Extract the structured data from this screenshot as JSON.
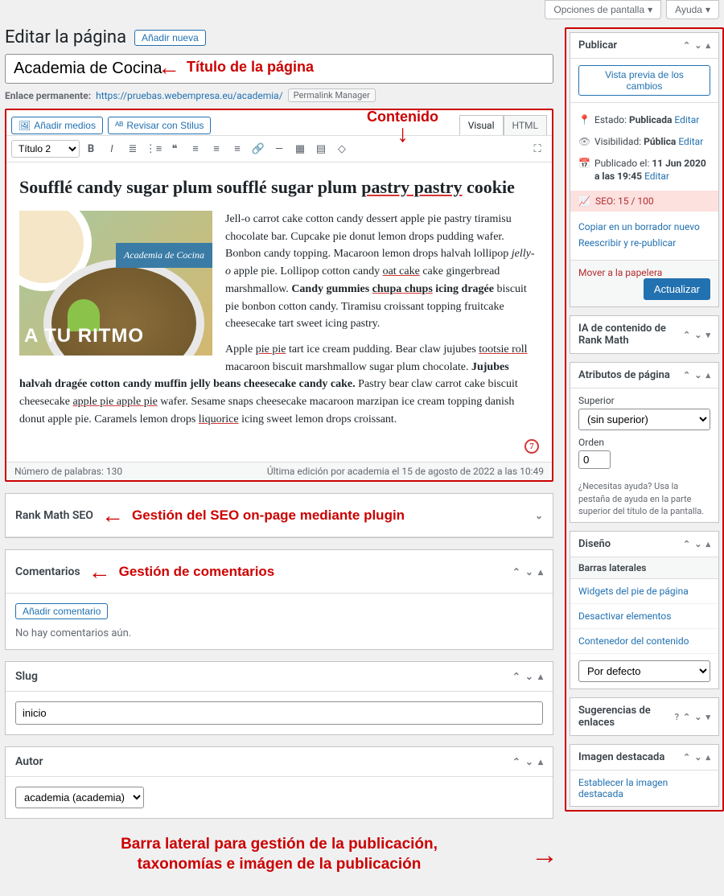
{
  "top": {
    "screen_options": "Opciones de pantalla",
    "help": "Ayuda"
  },
  "heading": {
    "title": "Editar la página",
    "add_new": "Añadir nueva"
  },
  "title_field": {
    "value": "Academia de Cocina"
  },
  "permalink": {
    "label": "Enlace permanente:",
    "url": "https://pruebas.webempresa.eu/academia/",
    "manager_btn": "Permalink Manager"
  },
  "editor_top": {
    "add_media": "Añadir medios",
    "stilus": "Revisar con Stilus",
    "tab_visual": "Visual",
    "tab_html": "HTML"
  },
  "tiny": {
    "format_sel": "Título 2"
  },
  "content": {
    "h2_a": "Soufflé candy sugar plum soufflé sugar plum ",
    "h2_u": "pastry pastry",
    "h2_b": " cookie",
    "img_band": "Academia de Cocina",
    "img_ritmo": "A TU RITMO",
    "p1_a": "Jell-o carrot cake cotton candy dessert apple pie pastry tiramisu chocolate bar. Cupcake pie donut lemon drops pudding wafer. Bonbon candy topping. Macaroon lemon drops halvah lollipop ",
    "p1_i": "jelly-o",
    "p1_b": " apple pie. Lollipop cotton candy ",
    "p1_u1": "oat cake",
    "p1_c": " cake gingerbread marshmallow. ",
    "p1_bold1": "Candy gummies ",
    "p1_u2": "chupa chups",
    "p1_bold2": " icing dragée",
    "p1_d": " biscuit pie bonbon cotton candy. Tiramisu croissant topping fruitcake cheesecake tart sweet icing pastry.",
    "p2_a": "Apple ",
    "p2_u1": "pie pie",
    "p2_b": " tart ice cream pudding. Bear claw jujubes ",
    "p2_u2": "tootsie roll",
    "p2_c": " macaroon biscuit marshmallow sugar plum chocolate. ",
    "p2_bold": "Jujubes halvah dragée cotton candy muffin jelly beans cheesecake candy cake.",
    "p2_d": " Pastry bear claw carrot cake biscuit cheesecake ",
    "p2_u3": "apple pie apple pie",
    "p2_e": " wafer. Sesame snaps cheesecake macaroon marzipan ice cream topping danish donut apple pie. Caramels lemon drops ",
    "p2_u4": "liquorice",
    "p2_f": " icing sweet lemon drops croissant.",
    "seo_num": "7"
  },
  "editor_footer": {
    "words": "Número de palabras: 130",
    "last_edit": "Última edición por academia el 15 de agosto de 2022 a las 10:49"
  },
  "metaboxes": {
    "rankmath": {
      "title": "Rank Math SEO"
    },
    "comments": {
      "title": "Comentarios",
      "add_btn": "Añadir comentario",
      "none": "No hay comentarios aún."
    },
    "slug": {
      "title": "Slug",
      "value": "inicio"
    },
    "author": {
      "title": "Autor",
      "value": "academia (academia)"
    }
  },
  "annotations": {
    "title": "Título de la página",
    "content": "Contenido",
    "seo": "Gestión del SEO on-page mediante plugin",
    "comments": "Gestión de comentarios",
    "sidebar1": "Barra lateral para gestión de la publicación,",
    "sidebar2": "taxonomías e imágen de la publicación"
  },
  "sidebar": {
    "publish": {
      "title": "Publicar",
      "preview": "Vista previa de los cambios",
      "status_lbl": "Estado:",
      "status_val": "Publicada",
      "edit": "Editar",
      "vis_lbl": "Visibilidad:",
      "vis_val": "Pública",
      "pub_lbl": "Publicado el:",
      "pub_val": "11 Jun 2020 a las 19:45",
      "seo_score": "SEO: 15 / 100",
      "copy": "Copiar en un borrador nuevo",
      "rewrite": "Reescribir y re-publicar",
      "trash": "Mover a la papelera",
      "update": "Actualizar"
    },
    "ia": {
      "title": "IA de contenido de Rank Math"
    },
    "attrs": {
      "title": "Atributos de página",
      "parent_lbl": "Superior",
      "parent_val": "(sin superior)",
      "order_lbl": "Orden",
      "order_val": "0",
      "help": "¿Necesitas ayuda? Usa la pestaña de ayuda en la parte superior del título de la pantalla."
    },
    "design": {
      "title": "Diseño",
      "sidebars": "Barras laterales",
      "widgets": "Widgets del pie de página",
      "disable": "Desactivar elementos",
      "container": "Contenedor del contenido",
      "default_sel": "Por defecto"
    },
    "links": {
      "title": "Sugerencias de enlaces"
    },
    "featured": {
      "title": "Imagen destacada",
      "set": "Establecer la imagen destacada"
    }
  }
}
